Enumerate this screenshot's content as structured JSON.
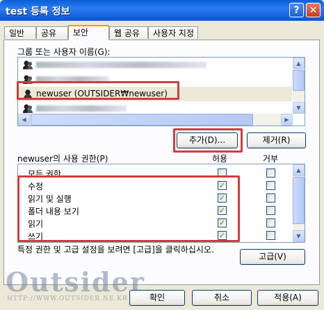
{
  "window": {
    "title": "test 등록 정보",
    "help": "?",
    "close": "✕"
  },
  "tabs": [
    "일반",
    "공유",
    "보안",
    "웹 공유",
    "사용자 지정"
  ],
  "active_tab": "보안",
  "users_section": {
    "label": "그룹 또는 사용자 이름(G):",
    "selected_user": "newuser (OUTSIDER₩newuser)"
  },
  "buttons": {
    "add": "추가(D)...",
    "remove": "제거(R)",
    "advanced": "고급(V)",
    "ok": "확인",
    "cancel": "취소",
    "apply": "적용(A)"
  },
  "permissions": {
    "label": "newuser의 사용 권한(P)",
    "allow_header": "허용",
    "deny_header": "거부",
    "rows": [
      {
        "name": "모든 권한",
        "allow": false,
        "deny": false
      },
      {
        "name": "수정",
        "allow": true,
        "deny": false
      },
      {
        "name": "읽기 및 실행",
        "allow": true,
        "deny": false
      },
      {
        "name": "폴더 내용 보기",
        "allow": true,
        "deny": false
      },
      {
        "name": "읽기",
        "allow": true,
        "deny": false
      },
      {
        "name": "쓰기",
        "allow": true,
        "deny": false
      }
    ]
  },
  "note": "특정 권한 및 고급 설정을 보려면 [고급]을 클릭하십시오.",
  "watermark": {
    "text": "Outsider",
    "url": "HTTP://WWW.OUTSIDER.NE.KR"
  },
  "colors": {
    "highlight_box": "#d23c3c",
    "titlebar": "#0a5fd8",
    "check": "#21a121"
  }
}
